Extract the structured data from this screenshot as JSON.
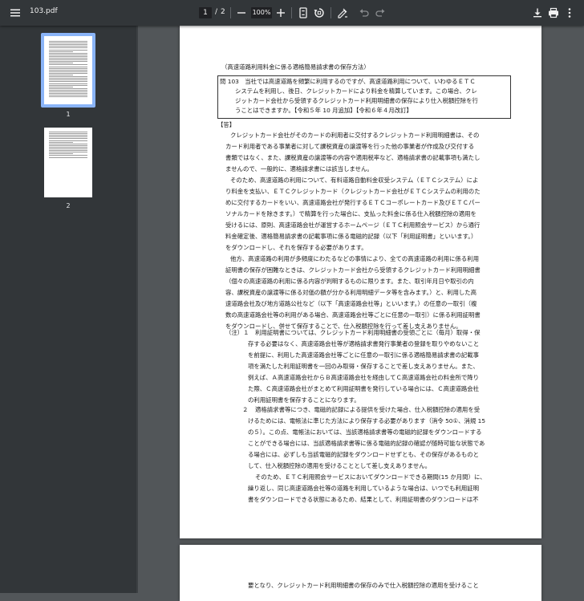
{
  "toolbar": {
    "file_name": "103.pdf",
    "current_page": "1",
    "page_separator": "/",
    "total_pages": "2",
    "zoom": "100%",
    "icons": [
      "menu-icon",
      "zoom-out-icon",
      "zoom-in-icon",
      "fit-page-icon",
      "rotate-icon",
      "annotate-icon",
      "undo-icon",
      "redo-icon",
      "download-icon",
      "print-icon",
      "more-icon"
    ]
  },
  "sidebar": {
    "thumbnails": [
      {
        "label": "1",
        "selected": true
      },
      {
        "label": "2",
        "selected": false
      }
    ]
  },
  "document": {
    "heading": "（高速道路利用料金に係る適格簡易請求書の保存方法）",
    "question_lines": [
      "問 103　当社では高速道路を頻繁に利用するのですが、高速道路利用について、いわゆるＥＴＣ",
      "システムを利用し、後日、クレジットカードにより料金を精算しています。この場合、クレ",
      "ジットカード会社から受領するクレジットカード利用明細書の保存により仕入税額控除を行",
      "うことはできますか。【令和５年 10 月追加】【令和６年４月改訂】"
    ],
    "answer_label": "【答】",
    "body_lines": [
      "クレジットカード会社がそのカードの利用者に交付するクレジットカード利用明細書は、その",
      "カード利用者である事業者に対して課税資産の譲渡等を行った他の事業者が作成及び交付する",
      "書類ではなく、また、課税資産の譲渡等の内容や適用税率など、適格請求書の記載事項も満たし",
      "ませんので、一般的に、適格請求書には該当しません。",
      "そのため、高速道路の利用について、有料道路自動料金収受システム（ＥＴＣシステム）によ",
      "り料金を支払い、ＥＴＣクレジットカード（クレジットカード会社がＥＴＣシステムの利用のた",
      "めに交付するカードをいい、高速道路会社が発行するＥＴＣコーポレートカード及びＥＴＣパー",
      "ソナルカードを除きます。）で精算を行った場合に、支払った料金に係る仕入税額控除の適用を",
      "受けるには、原則、高速道路会社が運営するホームページ（ＥＴＣ利用照会サービス）から通行",
      "料金確定後、適格簡易請求書の記載事項に係る電磁的記録（以下「利用証明書」といいます。）",
      "をダウンロードし、それを保存する必要があります。",
      "他方、高速道路の利用が多頻度にわたるなどの事情により、全ての高速道路の利用に係る利用",
      "証明書の保存が困難なときは、クレジットカード会社から受領するクレジットカード利用明細書",
      "（個々の高速道路の利用に係る内容が判明するものに限ります。また、取引年月日や取引の内",
      "容、課税資産の譲渡等に係る対価の額が分かる利用明細データ等を含みます。）と、利用した高",
      "速道路会社及び地方道路公社など（以下「高速道路会社等」といいます。）の任意の一取引（複",
      "数の高速道路会社等の利用がある場合、高速道路会社等ごとに任意の一取引）に係る利用証明書",
      "をダウンロードし、併せて保存することで、仕入税額控除を行って差し支えありません。"
    ],
    "note_label": "（注）１",
    "note1_lines": [
      "利用証明書については、クレジットカード利用明細書の受領ごとに（毎月）取得・保",
      "存する必要はなく、高速道路会社等が適格請求書発行事業者の登録を取りやめないこと",
      "を前提に、利用した高速道路会社等ごとに任意の一取引に係る適格簡易請求書の記載事",
      "項を満たした利用証明書を一回のみ取得・保存することで差し支えありません。また、",
      "例えば、Ａ高速道路会社からＢ高速道路会社を経由してＣ高速道路会社の料金所で降り",
      "た際、Ｃ高速道路会社がまとめて利用証明書を発行している場合には、Ｃ高速道路会社",
      "の利用証明書を保存することになります。"
    ],
    "note2_label": "２",
    "note2_lines": [
      "適格請求書等につき、電磁的記録による提供を受けた場合、仕入税額控除の適用を受",
      "けるためには、電帳法に準じた方法により保存する必要があります（消令 50①、消規 15",
      "の５）。この点、電帳法においては、当該適格請求書等の電磁的記録をダウンロードする",
      "ことができる場合には、当該適格請求書等に係る電磁的記録の確認が随時可能な状態であ",
      "る場合には、必ずしも当該電磁的記録をダウンロードせずとも、その保存があるものと",
      "して、仕入税額控除の適用を受けることとして差し支えありません。",
      "そのため、ＥＴＣ利用照会サービスにおいてダウンロードできる期間(15 か月間）に、",
      "繰り返し、同じ高速道路会社等の道路を利用しているような場合は、いつでも利用証明",
      "書をダウンロードできる状態にあるため、結果として、利用証明書のダウンロードは不"
    ],
    "page2_line": "要となり、クレジットカード利用明細書の保存のみで仕入税額控除の適用を受けること"
  }
}
